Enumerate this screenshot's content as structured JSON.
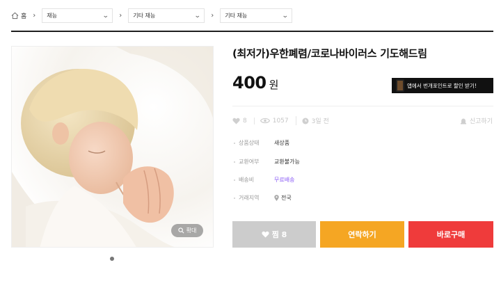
{
  "breadcrumb": {
    "home_label": "홈",
    "crumbs": [
      "재능",
      "기타 재능",
      "기타 재능"
    ]
  },
  "product": {
    "title": "(최저가)우한폐렴/코로나바이러스 기도해드림",
    "price": "400",
    "price_unit": "원",
    "app_banner": "앱에서 번개포인트로 할인 받기!",
    "likes": "8",
    "views": "1057",
    "time_ago": "3일 전",
    "report_label": "신고하기",
    "zoom_label": "확대",
    "info": [
      {
        "label": "상품상태",
        "value": "새상품"
      },
      {
        "label": "교환여부",
        "value": "교환불가능"
      },
      {
        "label": "배송비",
        "value": "무료배송"
      },
      {
        "label": "거래지역",
        "value": "전국"
      }
    ]
  },
  "actions": {
    "like_label": "찜 8",
    "contact_label": "연락하기",
    "buy_label": "바로구매"
  },
  "colors": {
    "like_button": "#cccccc",
    "contact_button": "#f5a623",
    "buy_button": "#ef3b3b",
    "free_shipping": "#8b5cf6"
  },
  "icons": [
    "home-icon",
    "chevron-down-icon",
    "heart-icon",
    "eye-icon",
    "clock-icon",
    "siren-icon",
    "search-icon",
    "map-pin-icon"
  ]
}
